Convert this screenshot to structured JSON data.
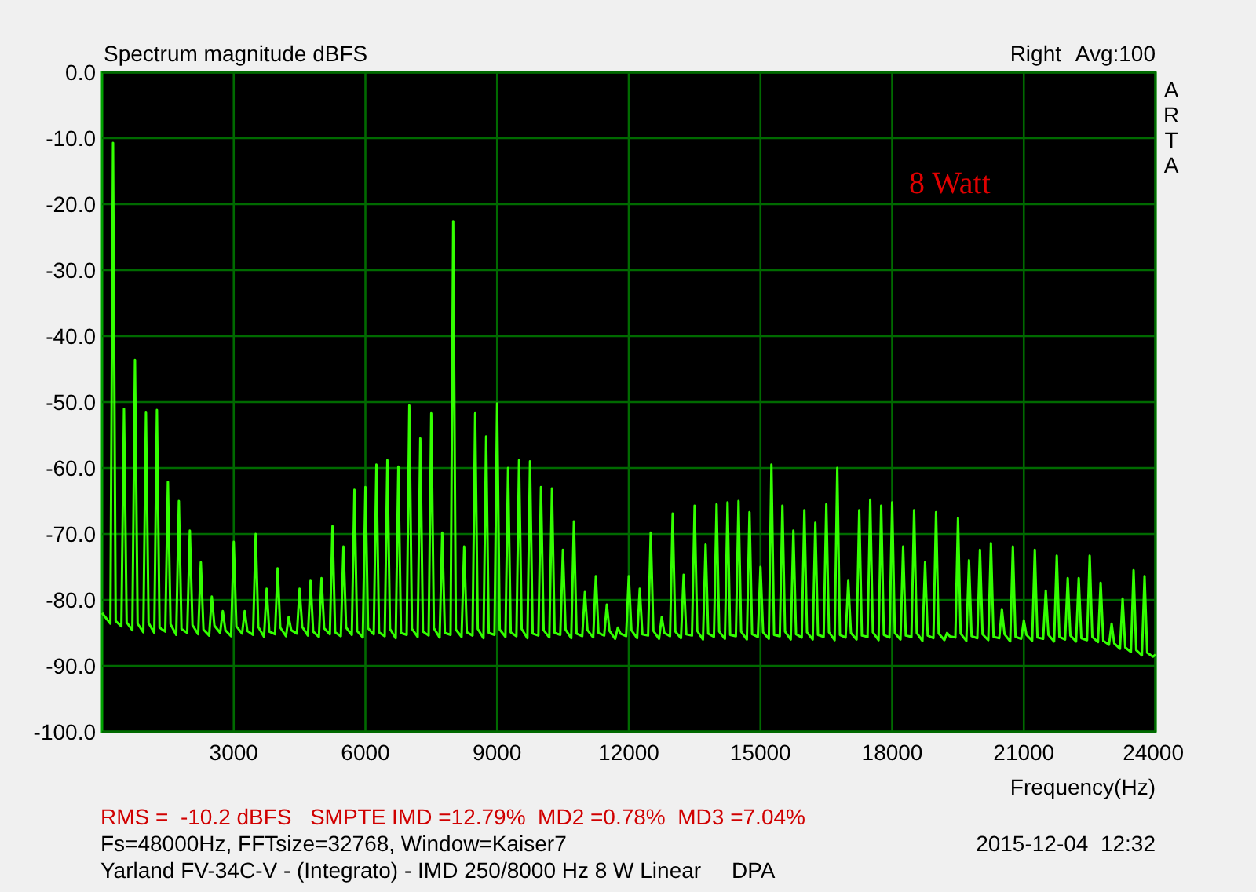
{
  "header": {
    "averaging": "Avg:100",
    "side_logo": "ARTA"
  },
  "chart_data": {
    "type": "line",
    "grid": true,
    "title": "Spectrum magnitude dBFS",
    "xlabel": "Frequency(Hz)",
    "xlim": [
      0,
      24000
    ],
    "ylim": [
      -100,
      0
    ],
    "xticks": [
      3000,
      6000,
      9000,
      12000,
      15000,
      18000,
      21000,
      24000
    ],
    "yticks": [
      {
        "value": 0,
        "label": "0.0"
      },
      {
        "value": -10,
        "label": "-10.0"
      },
      {
        "value": -20,
        "label": "-20.0"
      },
      {
        "value": -30,
        "label": "-30.0"
      },
      {
        "value": -40,
        "label": "-40.0"
      },
      {
        "value": -50,
        "label": "-50.0"
      },
      {
        "value": -60,
        "label": "-60.0"
      },
      {
        "value": -70,
        "label": "-70.0"
      },
      {
        "value": -80,
        "label": "-80.0"
      },
      {
        "value": -90,
        "label": "-90.0"
      },
      {
        "value": -100,
        "label": "-100.0"
      }
    ],
    "x": [
      0,
      60,
      190,
      250,
      310,
      440,
      500,
      560,
      690,
      750,
      810,
      940,
      1000,
      1060,
      1190,
      1250,
      1310,
      1440,
      1500,
      1560,
      1690,
      1750,
      1810,
      1940,
      2000,
      2060,
      2190,
      2250,
      2310,
      2440,
      2500,
      2560,
      2690,
      2750,
      2810,
      2940,
      3000,
      3060,
      3190,
      3250,
      3310,
      3440,
      3500,
      3560,
      3690,
      3750,
      3810,
      3940,
      4000,
      4060,
      4190,
      4250,
      4310,
      4440,
      4500,
      4560,
      4690,
      4750,
      4810,
      4940,
      5000,
      5060,
      5190,
      5250,
      5310,
      5440,
      5500,
      5560,
      5690,
      5750,
      5810,
      5940,
      6000,
      6060,
      6190,
      6250,
      6310,
      6440,
      6500,
      6560,
      6690,
      6750,
      6810,
      6940,
      7000,
      7060,
      7190,
      7250,
      7310,
      7440,
      7500,
      7560,
      7690,
      7750,
      7810,
      7940,
      8000,
      8060,
      8190,
      8250,
      8310,
      8440,
      8500,
      8560,
      8690,
      8750,
      8810,
      8940,
      9000,
      9060,
      9190,
      9250,
      9310,
      9440,
      9500,
      9560,
      9690,
      9750,
      9810,
      9940,
      10000,
      10060,
      10190,
      10250,
      10310,
      10440,
      10500,
      10560,
      10690,
      10750,
      10810,
      10940,
      11000,
      11060,
      11190,
      11250,
      11310,
      11440,
      11500,
      11560,
      11690,
      11750,
      11810,
      11940,
      12000,
      12060,
      12190,
      12250,
      12310,
      12440,
      12500,
      12560,
      12690,
      12750,
      12810,
      12940,
      13000,
      13060,
      13190,
      13250,
      13310,
      13440,
      13500,
      13560,
      13690,
      13750,
      13810,
      13940,
      14000,
      14060,
      14190,
      14250,
      14310,
      14440,
      14500,
      14560,
      14690,
      14750,
      14810,
      14940,
      15000,
      15060,
      15190,
      15250,
      15310,
      15440,
      15500,
      15560,
      15690,
      15750,
      15810,
      15940,
      16000,
      16060,
      16190,
      16250,
      16310,
      16440,
      16500,
      16560,
      16690,
      16750,
      16810,
      16940,
      17000,
      17060,
      17190,
      17250,
      17310,
      17440,
      17500,
      17560,
      17690,
      17750,
      17810,
      17940,
      18000,
      18060,
      18190,
      18250,
      18310,
      18440,
      18500,
      18560,
      18690,
      18750,
      18810,
      18940,
      19000,
      19060,
      19190,
      19250,
      19310,
      19440,
      19500,
      19560,
      19690,
      19750,
      19810,
      19940,
      20000,
      20060,
      20190,
      20250,
      20310,
      20440,
      20500,
      20560,
      20690,
      20750,
      20810,
      20940,
      21000,
      21060,
      21190,
      21250,
      21310,
      21440,
      21500,
      21560,
      21690,
      21750,
      21810,
      21940,
      22000,
      22060,
      22190,
      22250,
      22310,
      22440,
      22500,
      22560,
      22690,
      22750,
      22810,
      22940,
      23000,
      23060,
      23190,
      23250,
      23310,
      23440,
      23500,
      23560,
      23690,
      23750,
      23810,
      23940,
      24000
    ],
    "series": [
      {
        "name": "Right",
        "color": "#33ff00",
        "values": [
          -82,
          -82.5,
          -83.6,
          -10.7,
          -83.2,
          -84,
          -51,
          -83.4,
          -84.6,
          -43.6,
          -83.6,
          -84.9,
          -51.6,
          -83.5,
          -85,
          -51.2,
          -84.2,
          -84.8,
          -62.1,
          -83.7,
          -85.3,
          -65,
          -84.4,
          -85,
          -69.5,
          -83.8,
          -85.2,
          -74.3,
          -84.5,
          -85.4,
          -79.5,
          -83.9,
          -85,
          -81.7,
          -84.6,
          -85.5,
          -71.2,
          -84,
          -85.1,
          -81.7,
          -84.7,
          -85.3,
          -70,
          -84.1,
          -85.6,
          -78.3,
          -84.8,
          -85.2,
          -75.2,
          -84.2,
          -85.5,
          -82.6,
          -84.6,
          -85.1,
          -78.3,
          -84.1,
          -85.4,
          -77.1,
          -84.8,
          -85.6,
          -76.7,
          -84.3,
          -85.2,
          -68.8,
          -84.9,
          -85.5,
          -71.9,
          -84.2,
          -85.3,
          -63.3,
          -84.7,
          -85.7,
          -62.9,
          -84.3,
          -85.2,
          -59.5,
          -84.9,
          -85.5,
          -58.8,
          -84.4,
          -85.8,
          -59.8,
          -85,
          -85.3,
          -50.5,
          -84.4,
          -85.6,
          -55.5,
          -84.8,
          -85.4,
          -51.7,
          -84.3,
          -85.7,
          -69.8,
          -85,
          -85.3,
          -22.6,
          -84.5,
          -85.6,
          -71.9,
          -84.9,
          -85.4,
          -51.7,
          -84.4,
          -85.8,
          -55.2,
          -85,
          -85.3,
          -50.2,
          -84.5,
          -85.6,
          -60,
          -84.9,
          -85.5,
          -58.8,
          -84.4,
          -85.8,
          -59,
          -85.1,
          -85.4,
          -62.9,
          -84.6,
          -85.7,
          -63.1,
          -85,
          -85.3,
          -72.4,
          -84.5,
          -85.8,
          -68.1,
          -85.1,
          -85.5,
          -78.8,
          -84.6,
          -85.7,
          -76.4,
          -85,
          -85.4,
          -80.7,
          -84.7,
          -85.9,
          -84.2,
          -85.1,
          -85.5,
          -76.4,
          -84.6,
          -85.8,
          -78.3,
          -85.2,
          -85.4,
          -69.8,
          -84.7,
          -85.9,
          -82.6,
          -85,
          -85.5,
          -66.9,
          -84.8,
          -85.8,
          -76.2,
          -85.2,
          -85.4,
          -65.7,
          -84.7,
          -86,
          -71.6,
          -85.1,
          -85.6,
          -65.5,
          -84.8,
          -85.9,
          -65.2,
          -85.3,
          -85.5,
          -65,
          -84.8,
          -86,
          -66.7,
          -85.2,
          -85.6,
          -75,
          -84.9,
          -85.9,
          -59.5,
          -85.3,
          -85.5,
          -65.7,
          -84.8,
          -86,
          -69.5,
          -85.2,
          -85.7,
          -66.4,
          -84.9,
          -86,
          -68.3,
          -85.3,
          -85.6,
          -65.5,
          -84.9,
          -86.1,
          -60,
          -85.3,
          -85.7,
          -77.1,
          -85,
          -86,
          -66.4,
          -85.4,
          -85.6,
          -64.8,
          -84.9,
          -86.1,
          -65.7,
          -85.3,
          -85.7,
          -65.2,
          -85,
          -86,
          -71.9,
          -85.4,
          -85.6,
          -66.4,
          -85,
          -86.2,
          -74.3,
          -85.4,
          -85.8,
          -66.7,
          -85.1,
          -86.1,
          -85,
          -85.5,
          -85.7,
          -67.6,
          -85.1,
          -86.2,
          -74,
          -85.5,
          -85.8,
          -72.4,
          -85.2,
          -86.1,
          -71.4,
          -85.6,
          -85.8,
          -81.4,
          -85.2,
          -86.3,
          -71.9,
          -85.6,
          -85.9,
          -83.1,
          -85.3,
          -86.2,
          -72.4,
          -85.7,
          -85.9,
          -78.6,
          -85.3,
          -86.3,
          -73.3,
          -85.6,
          -86,
          -76.7,
          -85.4,
          -86.3,
          -76.7,
          -85.8,
          -86.1,
          -73.3,
          -85.6,
          -86.4,
          -77.4,
          -86.2,
          -86.8,
          -83.6,
          -86.6,
          -87.4,
          -79.8,
          -87.2,
          -87.9,
          -75.5,
          -87.6,
          -88.4,
          -76.4,
          -88,
          -88.6,
          -88.3
        ]
      }
    ],
    "annotations": [
      "8 Watt"
    ]
  },
  "footer": {
    "measurements": "RMS =  -10.2 dBFS   SMPTE IMD =12.79%  MD2 =0.78%  MD3 =7.04%",
    "settings": "Fs=48000Hz, FFTsize=32768, Window=Kaiser7",
    "timestamp": "2015-12-04  12:32",
    "description": "Yarland FV-34C-V - (Integrato) - IMD 250/8000 Hz 8 W Linear     DPA"
  }
}
